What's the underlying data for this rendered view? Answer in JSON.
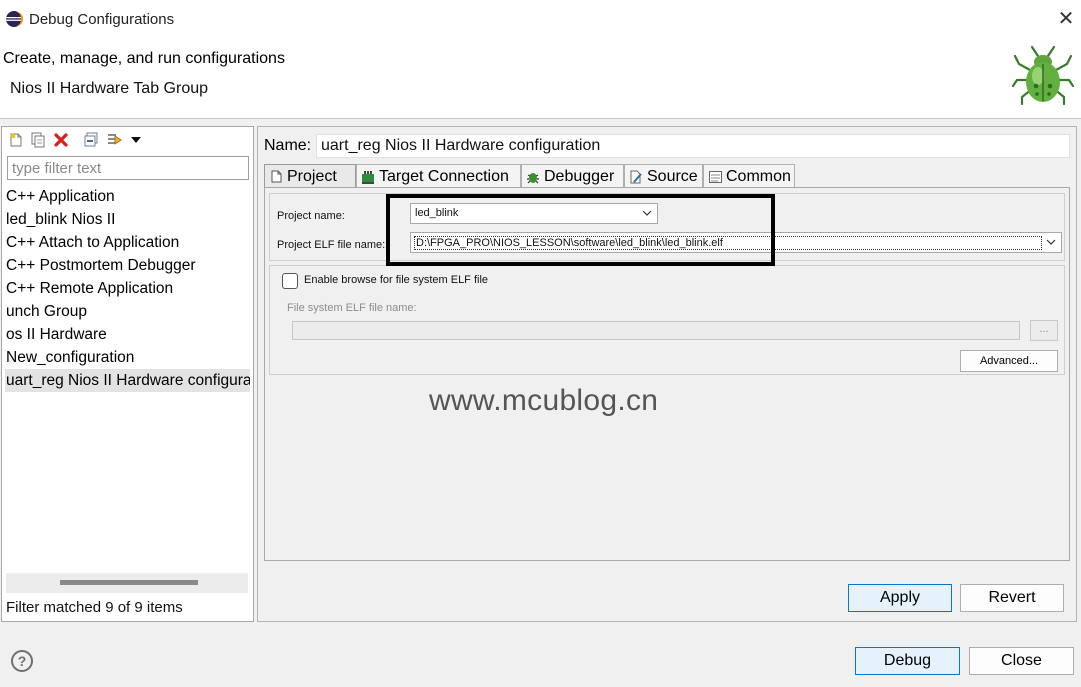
{
  "window": {
    "title": "Debug Configurations",
    "close_glyph": "✕"
  },
  "header": {
    "title": "Create, manage, and run configurations",
    "subtitle": "Nios II Hardware Tab Group",
    "icon": "bug-icon"
  },
  "left_panel": {
    "toolbar": [
      "new-configuration-icon",
      "duplicate-icon",
      "delete-icon",
      "collapse-all-icon",
      "filter-icon",
      "view-menu-icon"
    ],
    "filter_placeholder": "type filter text",
    "items": [
      {
        "label": "C++ Application",
        "selected": false
      },
      {
        "label": "led_blink Nios II",
        "selected": false
      },
      {
        "label": "C++ Attach to Application",
        "selected": false
      },
      {
        "label": "C++ Postmortem Debugger",
        "selected": false
      },
      {
        "label": "C++ Remote Application",
        "selected": false
      },
      {
        "label": "unch Group",
        "selected": false
      },
      {
        "label": "os II Hardware",
        "selected": false
      },
      {
        "label": "New_configuration",
        "selected": false
      },
      {
        "label": "uart_reg Nios II Hardware configuration",
        "selected": true
      }
    ],
    "status": "Filter matched 9 of 9 items"
  },
  "right_panel": {
    "name_label": "Name:",
    "name_value": "uart_reg Nios II Hardware configuration",
    "tabs": [
      {
        "label": "Project",
        "icon": "project-icon",
        "active": true
      },
      {
        "label": "Target Connection",
        "icon": "target-connection-icon",
        "active": false
      },
      {
        "label": "Debugger",
        "icon": "debugger-icon",
        "active": false
      },
      {
        "label": "Source",
        "icon": "source-icon",
        "active": false
      },
      {
        "label": "Common",
        "icon": "common-icon",
        "active": false
      }
    ],
    "project": {
      "project_name_label": "Project name:",
      "project_name_value": "led_blink",
      "elf_label": "Project ELF file name:",
      "elf_value": "D:\\FPGA_PRO\\NIOS_LESSON\\software\\led_blink\\led_blink.elf",
      "browse_checkbox_label": "Enable browse for file system ELF file",
      "browse_checked": false,
      "fs_elf_label": "File system ELF file name:",
      "fs_elf_browse": "...",
      "advanced": "Advanced..."
    },
    "watermark": "www.mcublog.cn",
    "apply": "Apply",
    "revert": "Revert"
  },
  "footer": {
    "help_glyph": "?",
    "debug": "Debug",
    "close": "Close"
  },
  "colors": {
    "accent_border": "#0078d7",
    "accent_fill": "#e5f1fb",
    "selection": "#e3e3e3"
  }
}
